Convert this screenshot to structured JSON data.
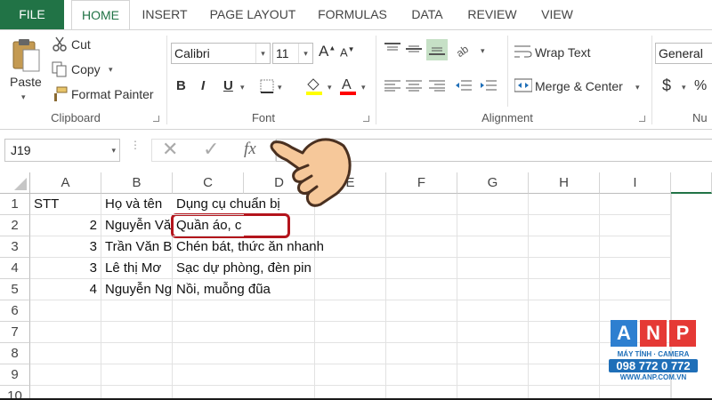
{
  "tabs": [
    "FILE",
    "HOME",
    "INSERT",
    "PAGE LAYOUT",
    "FORMULAS",
    "DATA",
    "REVIEW",
    "VIEW"
  ],
  "clipboard": {
    "paste": "Paste",
    "cut": "Cut",
    "copy": "Copy",
    "format_painter": "Format Painter",
    "label": "Clipboard"
  },
  "font": {
    "name": "Calibri",
    "size": "11",
    "bold": "B",
    "italic": "I",
    "underline": "U",
    "label": "Font",
    "fill_color": "#ffff00",
    "font_color": "#ff0000"
  },
  "alignment": {
    "wrap": "Wrap Text",
    "merge": "Merge & Center",
    "label": "Alignment"
  },
  "number": {
    "format": "General",
    "currency": "$",
    "percent": "%",
    "label": "Nu"
  },
  "formula_bar": {
    "name_box": "J19",
    "fx": "fx",
    "value": ""
  },
  "columns": [
    "A",
    "B",
    "C",
    "D",
    "E",
    "F",
    "G",
    "H",
    "I"
  ],
  "rows": [
    {
      "n": "1",
      "a": "STT",
      "b": "Họ và tên",
      "c": "Dụng cụ chuẩn bị"
    },
    {
      "n": "2",
      "a": "2",
      "b": "Nguyễn Văn",
      "c": "Quần áo, c"
    },
    {
      "n": "3",
      "a": "3",
      "b": "Trần Văn B",
      "c": "Chén bát, thức ăn nhanh"
    },
    {
      "n": "4",
      "a": "3",
      "b": "Lê thị Mơ",
      "c": "Sạc dự phòng, đèn pin"
    },
    {
      "n": "5",
      "a": "4",
      "b": "Nguyễn Ng",
      "c": "Nồi, muỗng đũa"
    },
    {
      "n": "6",
      "a": "",
      "b": "",
      "c": ""
    },
    {
      "n": "7",
      "a": "",
      "b": "",
      "c": ""
    },
    {
      "n": "8",
      "a": "",
      "b": "",
      "c": ""
    },
    {
      "n": "9",
      "a": "",
      "b": "",
      "c": ""
    },
    {
      "n": "10",
      "a": "",
      "b": "",
      "c": ""
    }
  ],
  "logo": {
    "letters": [
      "A",
      "N",
      "P"
    ],
    "line1": "MÁY TÍNH · CAMERA",
    "line2": "098 772 0 772",
    "line3": "WWW.ANP.COM.VN",
    "color_a": "#2e7fd0",
    "color_n": "#e53935",
    "color_p": "#e53935"
  },
  "colors": {
    "accent": "#217346",
    "highlight": "#b3141c"
  }
}
